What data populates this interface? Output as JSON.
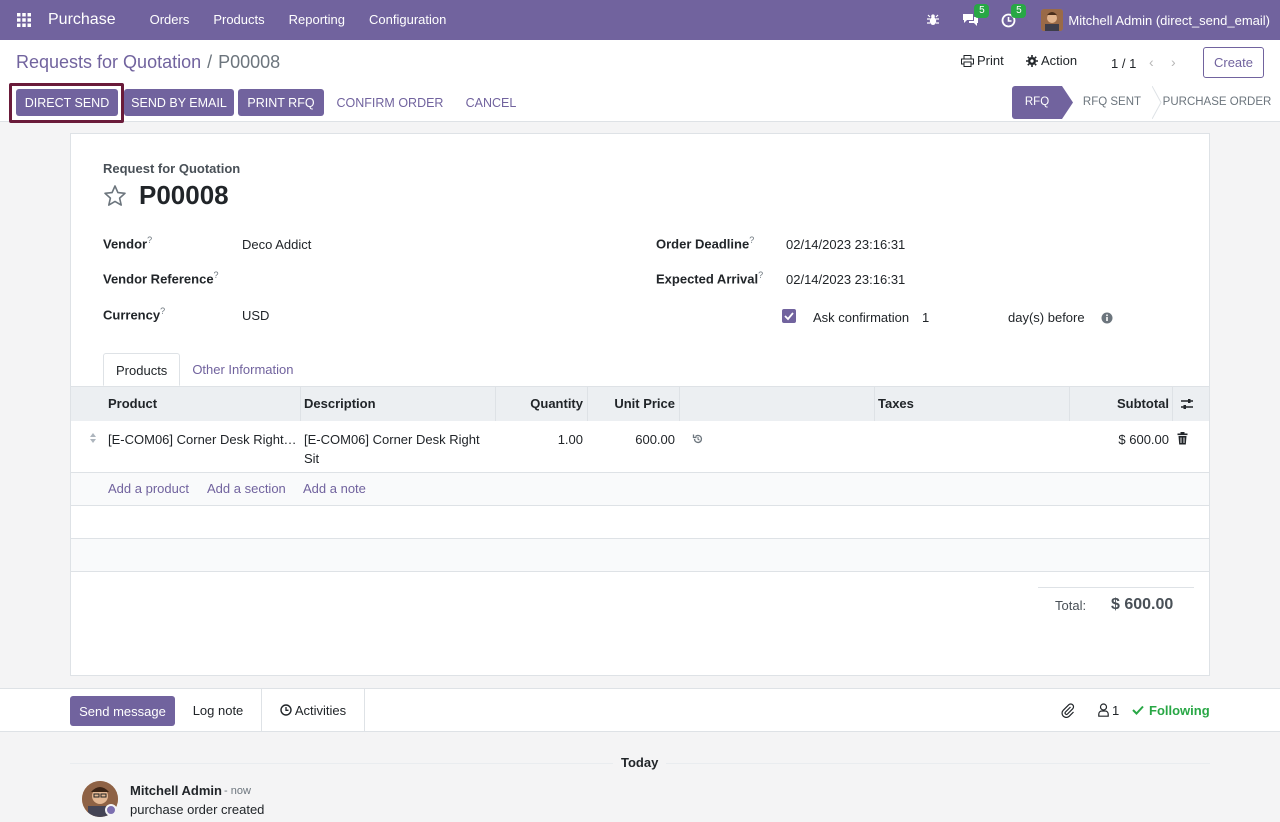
{
  "navbar": {
    "app_name": "Purchase",
    "menus": [
      "Orders",
      "Products",
      "Reporting",
      "Configuration"
    ],
    "messages_count": "5",
    "activities_count": "5",
    "user": "Mitchell Admin (direct_send_email)"
  },
  "breadcrumb": {
    "parent": "Requests for Quotation",
    "current": "P00008"
  },
  "control": {
    "print": "Print",
    "action": "Action",
    "pager": "1 / 1",
    "create": "Create"
  },
  "statusbar_buttons": {
    "direct_send": "Direct Send",
    "send_by_email": "Send by Email",
    "print_rfq": "Print RFQ",
    "confirm_order": "Confirm Order",
    "cancel": "Cancel"
  },
  "stages": [
    "RFQ",
    "RFQ Sent",
    "Purchase Order"
  ],
  "form": {
    "doc_label": "Request for Quotation",
    "name": "P00008",
    "vendor_label": "Vendor",
    "vendor": "Deco Addict",
    "vendor_ref_label": "Vendor Reference",
    "vendor_ref": "",
    "currency_label": "Currency",
    "currency": "USD",
    "deadline_label": "Order Deadline",
    "deadline": "02/14/2023 23:16:31",
    "arrival_label": "Expected Arrival",
    "arrival": "02/14/2023 23:16:31",
    "ask_confirm_label": "Ask confirmation",
    "ask_confirm_days": "1",
    "ask_confirm_suffix": "day(s) before",
    "help_mark": "?"
  },
  "tabs": [
    "Products",
    "Other Information"
  ],
  "lines": {
    "headers": [
      "Product",
      "Description",
      "Quantity",
      "Unit Price",
      "Taxes",
      "Subtotal"
    ],
    "rows": [
      {
        "product": "[E-COM06] Corner Desk Right…",
        "description_l1": "[E-COM06] Corner Desk Right",
        "description_l2": "Sit",
        "quantity": "1.00",
        "unit_price": "600.00",
        "taxes": "",
        "subtotal": "$ 600.00"
      }
    ],
    "add_product": "Add a product",
    "add_section": "Add a section",
    "add_note": "Add a note"
  },
  "totals": {
    "label": "Total:",
    "value": "$ 600.00"
  },
  "chatter": {
    "send_message": "Send message",
    "log_note": "Log note",
    "activities": "Activities",
    "followers": "1",
    "following": "Following",
    "date_label": "Today",
    "message": {
      "author": "Mitchell Admin",
      "time": "- now",
      "body": "purchase order created"
    }
  },
  "colors": {
    "brand": "#71639e",
    "success": "#28a745",
    "highlight": "#6a1b3a"
  }
}
